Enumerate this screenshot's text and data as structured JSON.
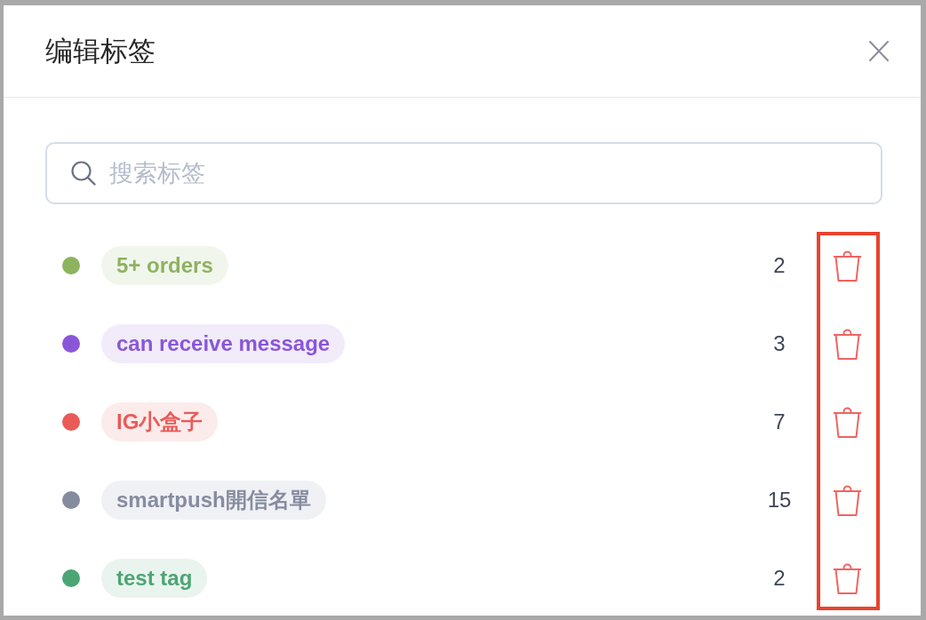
{
  "dialog": {
    "title": "编辑标签",
    "search": {
      "placeholder": "搜索标签"
    },
    "tags": [
      {
        "label": "5+ orders",
        "color": "#8db35f",
        "count": "2"
      },
      {
        "label": "can receive message",
        "color": "#8a56d8",
        "count": "3"
      },
      {
        "label": "IG小盒子",
        "color": "#ea5a57",
        "count": "7"
      },
      {
        "label": "smartpush開信名單",
        "color": "#868ca0",
        "count": "15"
      },
      {
        "label": "test tag",
        "color": "#4ca574",
        "count": "2"
      }
    ]
  }
}
